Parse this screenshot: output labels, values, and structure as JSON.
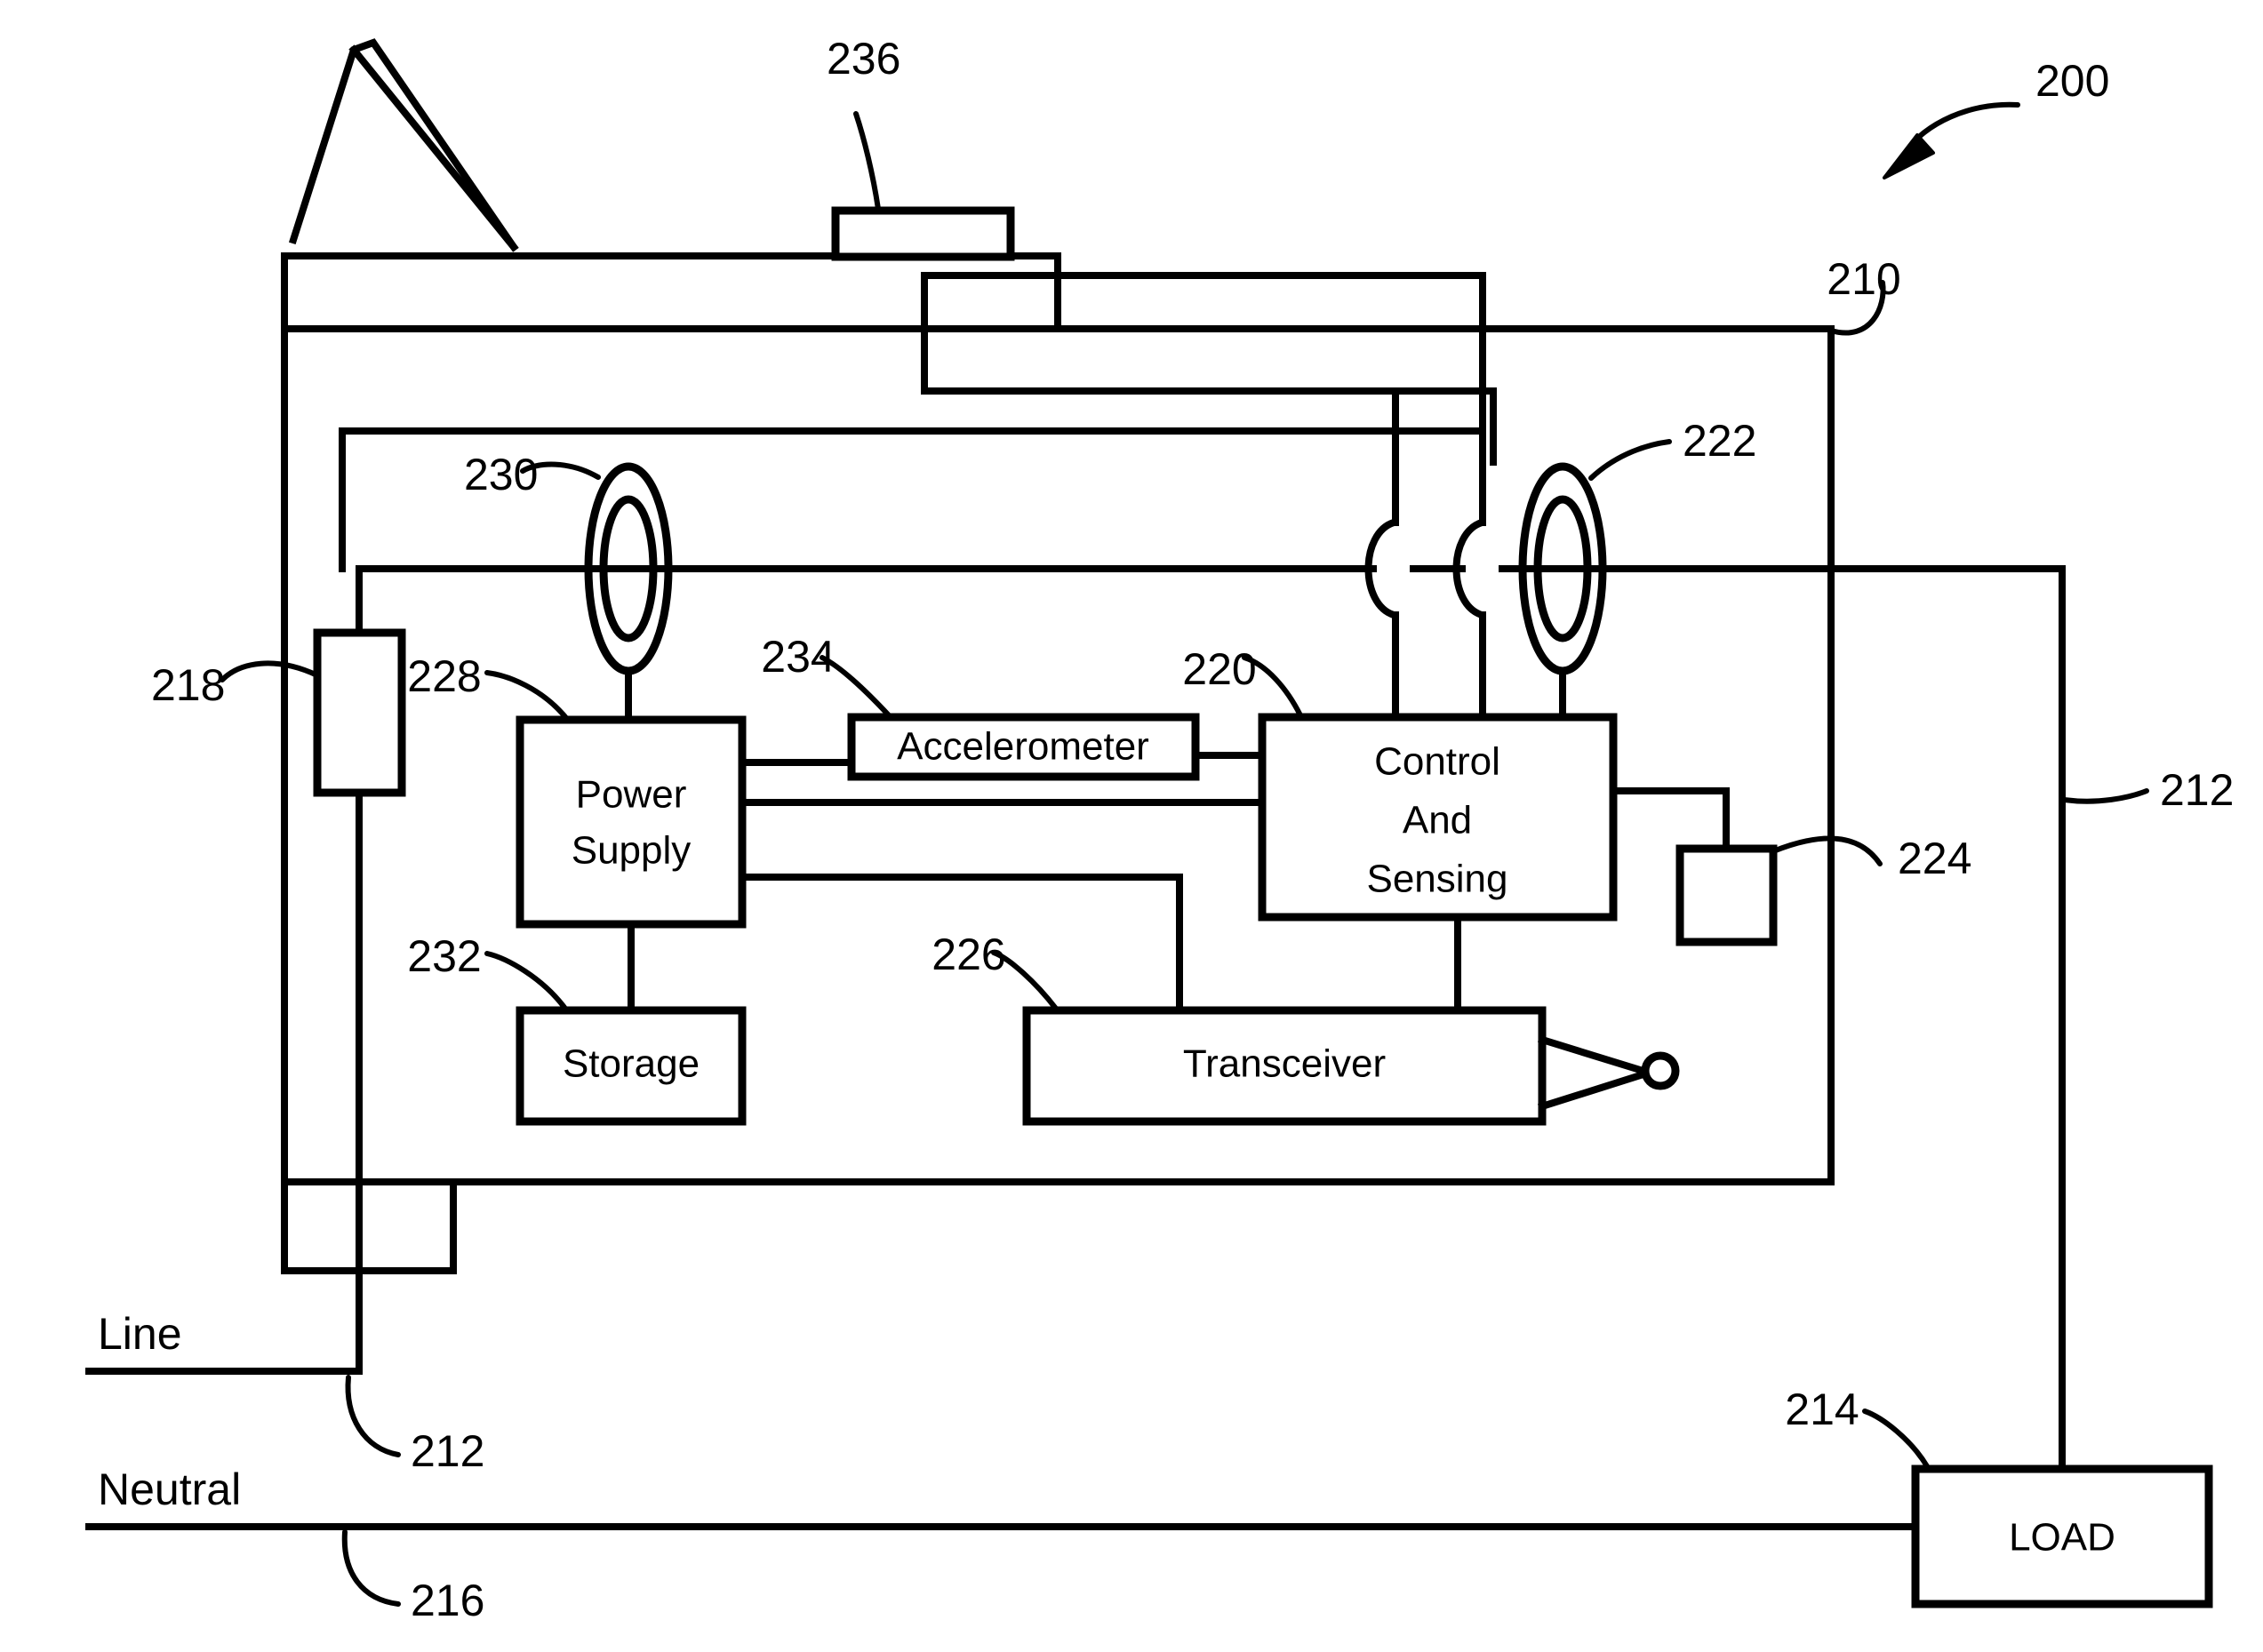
{
  "figure": {
    "type": "patent-diagram",
    "title_numeral": "200",
    "description": "Electrical circuit interrupter device schematic"
  },
  "blocks": {
    "power_supply": "Power\nSupply",
    "power_supply_line1": "Power",
    "power_supply_line2": "Supply",
    "accelerometer": "Accelerometer",
    "control_sensing_line1": "Control",
    "control_sensing_line2": "And",
    "control_sensing_line3": "Sensing",
    "storage": "Storage",
    "transceiver": "Transceiver",
    "load": "LOAD"
  },
  "rails": {
    "line": "Line",
    "neutral": "Neutral"
  },
  "reference_numerals": {
    "device": "200",
    "housing": "210",
    "line_conductor": "212",
    "line_conductor_right": "212",
    "load": "214",
    "neutral_conductor": "216",
    "switch_contact": "218",
    "control_and_sensing": "220",
    "sensor_coil_222": "222",
    "indicator_224": "224",
    "transceiver": "226",
    "power_supply": "228",
    "power_coil_230": "230",
    "storage": "232",
    "accelerometer": "234",
    "test_button": "236"
  },
  "icons": {
    "toggle_lever": "toggle-lever-icon",
    "antenna": "antenna-icon",
    "toroid_coil": "toroid-coil-icon",
    "wire_hop": "wire-hop-icon",
    "callout_arrow": "callout-arrow-icon"
  },
  "colors": {
    "stroke": "#000000",
    "background": "#ffffff"
  }
}
